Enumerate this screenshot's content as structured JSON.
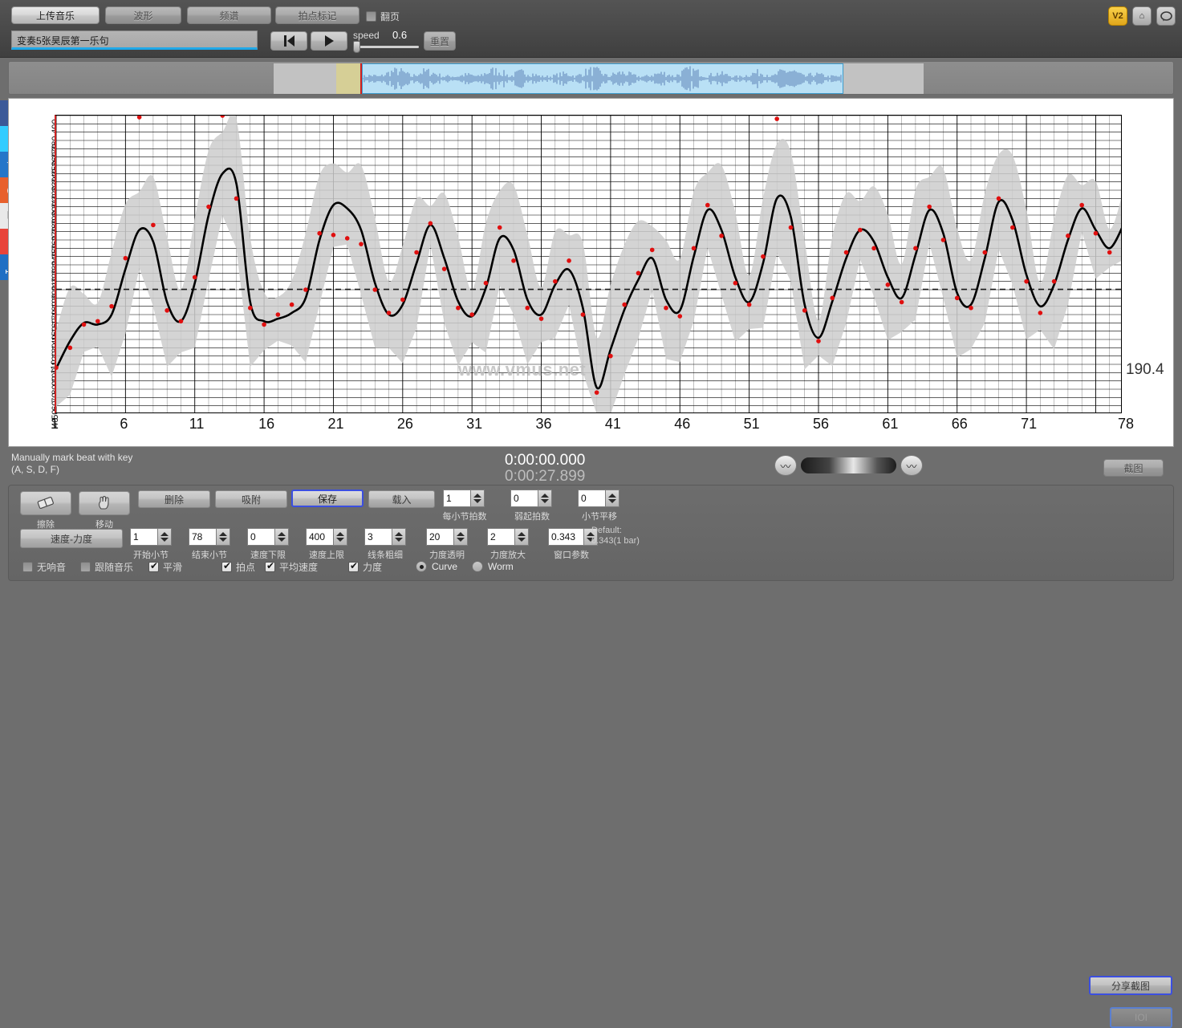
{
  "top_toolbar": {
    "buttons": [
      {
        "id": "upload",
        "label": "上传音乐"
      },
      {
        "id": "waveform",
        "label": "波形"
      },
      {
        "id": "spectrum",
        "label": "频谱"
      },
      {
        "id": "beatmark",
        "label": "拍点标记"
      }
    ],
    "page_flip": {
      "label": "翻页",
      "checked": false
    },
    "track_name": "变奏5张昊辰第一乐句",
    "speed_label": "speed",
    "speed_value": "0.6",
    "reset_label": "重置",
    "icons": [
      {
        "name": "v2-badge",
        "text": "V2"
      },
      {
        "name": "home-icon",
        "text": "⌂"
      },
      {
        "name": "chat-icon",
        "text": "💬"
      }
    ]
  },
  "social_rail": [
    {
      "name": "facebook-icon",
      "text": "f"
    },
    {
      "name": "twitter-icon",
      "text": "t"
    },
    {
      "name": "favorite-star-icon",
      "text": "★"
    },
    {
      "name": "sina-weibo-icon",
      "text": "◉"
    },
    {
      "name": "email-icon",
      "text": "✉"
    },
    {
      "name": "more-share-icon",
      "text": "+"
    },
    {
      "name": "help-icon",
      "text": "?",
      "sub": "HELP"
    }
  ],
  "chart_data": {
    "type": "line",
    "title": "",
    "xlabel": "",
    "ylabel": "",
    "xlim": [
      1,
      78
    ],
    "ylim": [
      40,
      400
    ],
    "xticks": [
      1,
      6,
      11,
      16,
      21,
      26,
      31,
      36,
      41,
      46,
      51,
      56,
      61,
      66,
      71,
      78
    ],
    "yticks": [
      400,
      380,
      370,
      360,
      350,
      340,
      330,
      320,
      310,
      300,
      290,
      280,
      270,
      260,
      250,
      240,
      230,
      220,
      210,
      200,
      190,
      180,
      170,
      160,
      150,
      140,
      130,
      120,
      110,
      100,
      90,
      80,
      70,
      60,
      50,
      40
    ],
    "grid": true,
    "legend": false,
    "reference_line": {
      "value": 190.4,
      "label": "190.4",
      "style": "dashed"
    },
    "series": [
      {
        "name": "tempo-curve",
        "type": "line",
        "color": "#000000",
        "x": [
          1,
          2,
          3,
          4,
          5,
          6,
          7,
          8,
          9,
          10,
          11,
          12,
          13,
          14,
          15,
          16,
          17,
          18,
          19,
          20,
          21,
          22,
          23,
          24,
          25,
          26,
          27,
          28,
          29,
          30,
          31,
          32,
          33,
          34,
          35,
          36,
          37,
          38,
          39,
          40,
          41,
          42,
          43,
          44,
          45,
          46,
          47,
          48,
          49,
          50,
          51,
          52,
          53,
          54,
          55,
          56,
          57,
          58,
          59,
          60,
          61,
          62,
          63,
          64,
          65,
          66,
          67,
          68,
          69,
          70,
          71,
          72,
          73,
          74,
          75,
          76,
          77,
          78
        ],
        "y": [
          95,
          128,
          150,
          148,
          160,
          215,
          262,
          248,
          175,
          152,
          198,
          280,
          330,
          318,
          175,
          152,
          155,
          162,
          180,
          250,
          292,
          288,
          262,
          198,
          160,
          172,
          222,
          268,
          228,
          176,
          158,
          192,
          252,
          238,
          178,
          160,
          196,
          214,
          168,
          72,
          118,
          166,
          202,
          228,
          178,
          165,
          230,
          286,
          262,
          205,
          175,
          222,
          300,
          278,
          172,
          132,
          176,
          228,
          262,
          248,
          205,
          180,
          232,
          286,
          258,
          186,
          172,
          228,
          296,
          274,
          208,
          170,
          196,
          250,
          288,
          262,
          240,
          268
        ]
      },
      {
        "name": "tempo-band",
        "type": "area",
        "color": "#cfcfcf",
        "description": "gray confidence band around tempo curve"
      },
      {
        "name": "beat-markers",
        "type": "scatter",
        "color": "#e01010",
        "x": [
          1,
          2,
          3,
          4,
          5,
          6,
          7,
          8,
          9,
          10,
          11,
          12,
          13,
          14,
          15,
          16,
          17,
          18,
          19,
          20,
          21,
          22,
          23,
          24,
          25,
          26,
          27,
          28,
          29,
          30,
          31,
          32,
          33,
          34,
          35,
          36,
          37,
          38,
          39,
          40,
          41,
          42,
          43,
          44,
          45,
          46,
          47,
          48,
          49,
          50,
          51,
          52,
          53,
          54,
          55,
          56,
          57,
          58,
          59,
          60,
          61,
          62,
          63,
          64,
          65,
          66,
          67,
          68,
          69,
          70,
          71,
          72,
          73,
          74,
          75,
          76,
          77
        ],
        "y": [
          96,
          120,
          148,
          152,
          170,
          228,
          398,
          268,
          165,
          152,
          205,
          290,
          400,
          300,
          168,
          148,
          160,
          172,
          190,
          258,
          256,
          252,
          245,
          190,
          162,
          178,
          235,
          270,
          215,
          168,
          160,
          198,
          265,
          225,
          168,
          155,
          200,
          225,
          160,
          66,
          110,
          172,
          210,
          238,
          168,
          158,
          240,
          292,
          255,
          198,
          172,
          230,
          396,
          265,
          165,
          128,
          180,
          235,
          262,
          240,
          196,
          175,
          240,
          290,
          250,
          180,
          168,
          235,
          300,
          265,
          200,
          162,
          200,
          255,
          292,
          258,
          235
        ]
      }
    ]
  },
  "chart_footer": {
    "hint_line1": "Manually mark beat with key",
    "hint_line2": "(A, S, D, F)",
    "time_current": "0:00:00.000",
    "time_total": "0:00:27.899",
    "capture_label": "截图",
    "watermark": "www.vmus.net"
  },
  "bottom_panel": {
    "tools": [
      {
        "id": "erase",
        "label": "擦除",
        "icon": "eraser-icon"
      },
      {
        "id": "move",
        "label": "移动",
        "icon": "hand-move-icon"
      }
    ],
    "actions": [
      {
        "id": "delete",
        "label": "删除",
        "highlight": false
      },
      {
        "id": "snap",
        "label": "吸附",
        "highlight": false
      },
      {
        "id": "save",
        "label": "保存",
        "highlight": true
      },
      {
        "id": "load",
        "label": "载入",
        "highlight": false
      }
    ],
    "tempo_force_label": "速度-力度",
    "spinners_row1": [
      {
        "id": "beats-per-bar",
        "value": "1",
        "label": "每小节拍数"
      },
      {
        "id": "pickup-beats",
        "value": "0",
        "label": "弱起拍数"
      },
      {
        "id": "bar-shift",
        "value": "0",
        "label": "小节平移"
      }
    ],
    "spinners_row2": [
      {
        "id": "start-bar",
        "value": "1",
        "label": "开始小节"
      },
      {
        "id": "end-bar",
        "value": "78",
        "label": "结束小节"
      },
      {
        "id": "tempo-min",
        "value": "0",
        "label": "速度下限"
      },
      {
        "id": "tempo-max",
        "value": "400",
        "label": "速度上限"
      },
      {
        "id": "line-width",
        "value": "3",
        "label": "线条粗细"
      },
      {
        "id": "force-opacity",
        "value": "20",
        "label": "力度透明"
      },
      {
        "id": "force-scale",
        "value": "2",
        "label": "力度放大"
      },
      {
        "id": "window-param",
        "value": "0.343",
        "label": "窗口参数"
      }
    ],
    "default_note_line1": "Default:",
    "default_note_line2": "0.343(1 bar)",
    "checkboxes": [
      {
        "id": "no-echo",
        "label": "无响音",
        "checked": false
      },
      {
        "id": "follow-music",
        "label": "跟随音乐",
        "checked": false
      },
      {
        "id": "smooth",
        "label": "平滑",
        "checked": true
      },
      {
        "id": "beat",
        "label": "拍点",
        "checked": true
      },
      {
        "id": "avg-tempo",
        "label": "平均速度",
        "checked": true
      },
      {
        "id": "force",
        "label": "力度",
        "checked": true
      }
    ],
    "radios": [
      {
        "id": "curve",
        "label": "Curve",
        "checked": true
      },
      {
        "id": "worm",
        "label": "Worm",
        "checked": false
      }
    ],
    "share_label": "分享截图",
    "icon_button_label": "IOI"
  },
  "colors": {
    "accent_blue": "#3b4fe0",
    "marker_red": "#e01010",
    "band_gray": "#cfcfcf",
    "panel_gray": "#6e6e6e",
    "axis_red": "#cf2222"
  }
}
